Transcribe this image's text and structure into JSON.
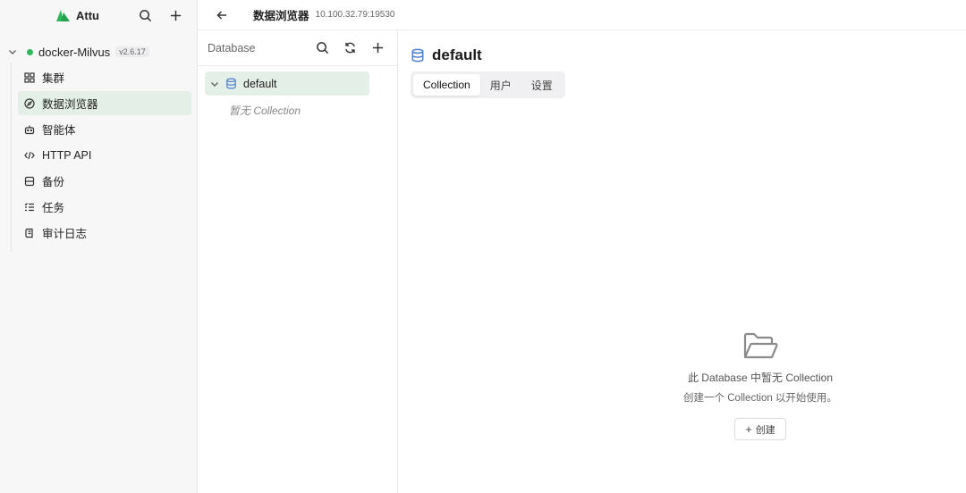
{
  "app": {
    "title": "Attu"
  },
  "instance": {
    "name": "docker-Milvus",
    "version": "v2.6.17",
    "status_color": "#2eb85c"
  },
  "nav": {
    "items": [
      {
        "label": "集群",
        "icon": "grid-icon"
      },
      {
        "label": "数据浏览器",
        "icon": "compass-icon",
        "active": true
      },
      {
        "label": "智能体",
        "icon": "robot-icon"
      },
      {
        "label": "HTTP API",
        "icon": "code-icon"
      },
      {
        "label": "备份",
        "icon": "backup-icon"
      },
      {
        "label": "任务",
        "icon": "list-icon"
      },
      {
        "label": "审计日志",
        "icon": "log-icon"
      }
    ]
  },
  "database_panel": {
    "title": "Database",
    "db_name": "default",
    "empty_collection": "暂无 Collection"
  },
  "topbar": {
    "title": "数据浏览器",
    "address": "10.100.32.79:19530"
  },
  "content": {
    "title": "default",
    "tabs": [
      "Collection",
      "用户",
      "设置"
    ],
    "active_tab": "Collection",
    "empty_title": "此 Database 中暂无 Collection",
    "empty_sub": "创建一个 Collection 以开始使用。",
    "create_label": "创建"
  },
  "colors": {
    "accent": "#e4efe7",
    "db_icon": "#4a7fd4"
  }
}
